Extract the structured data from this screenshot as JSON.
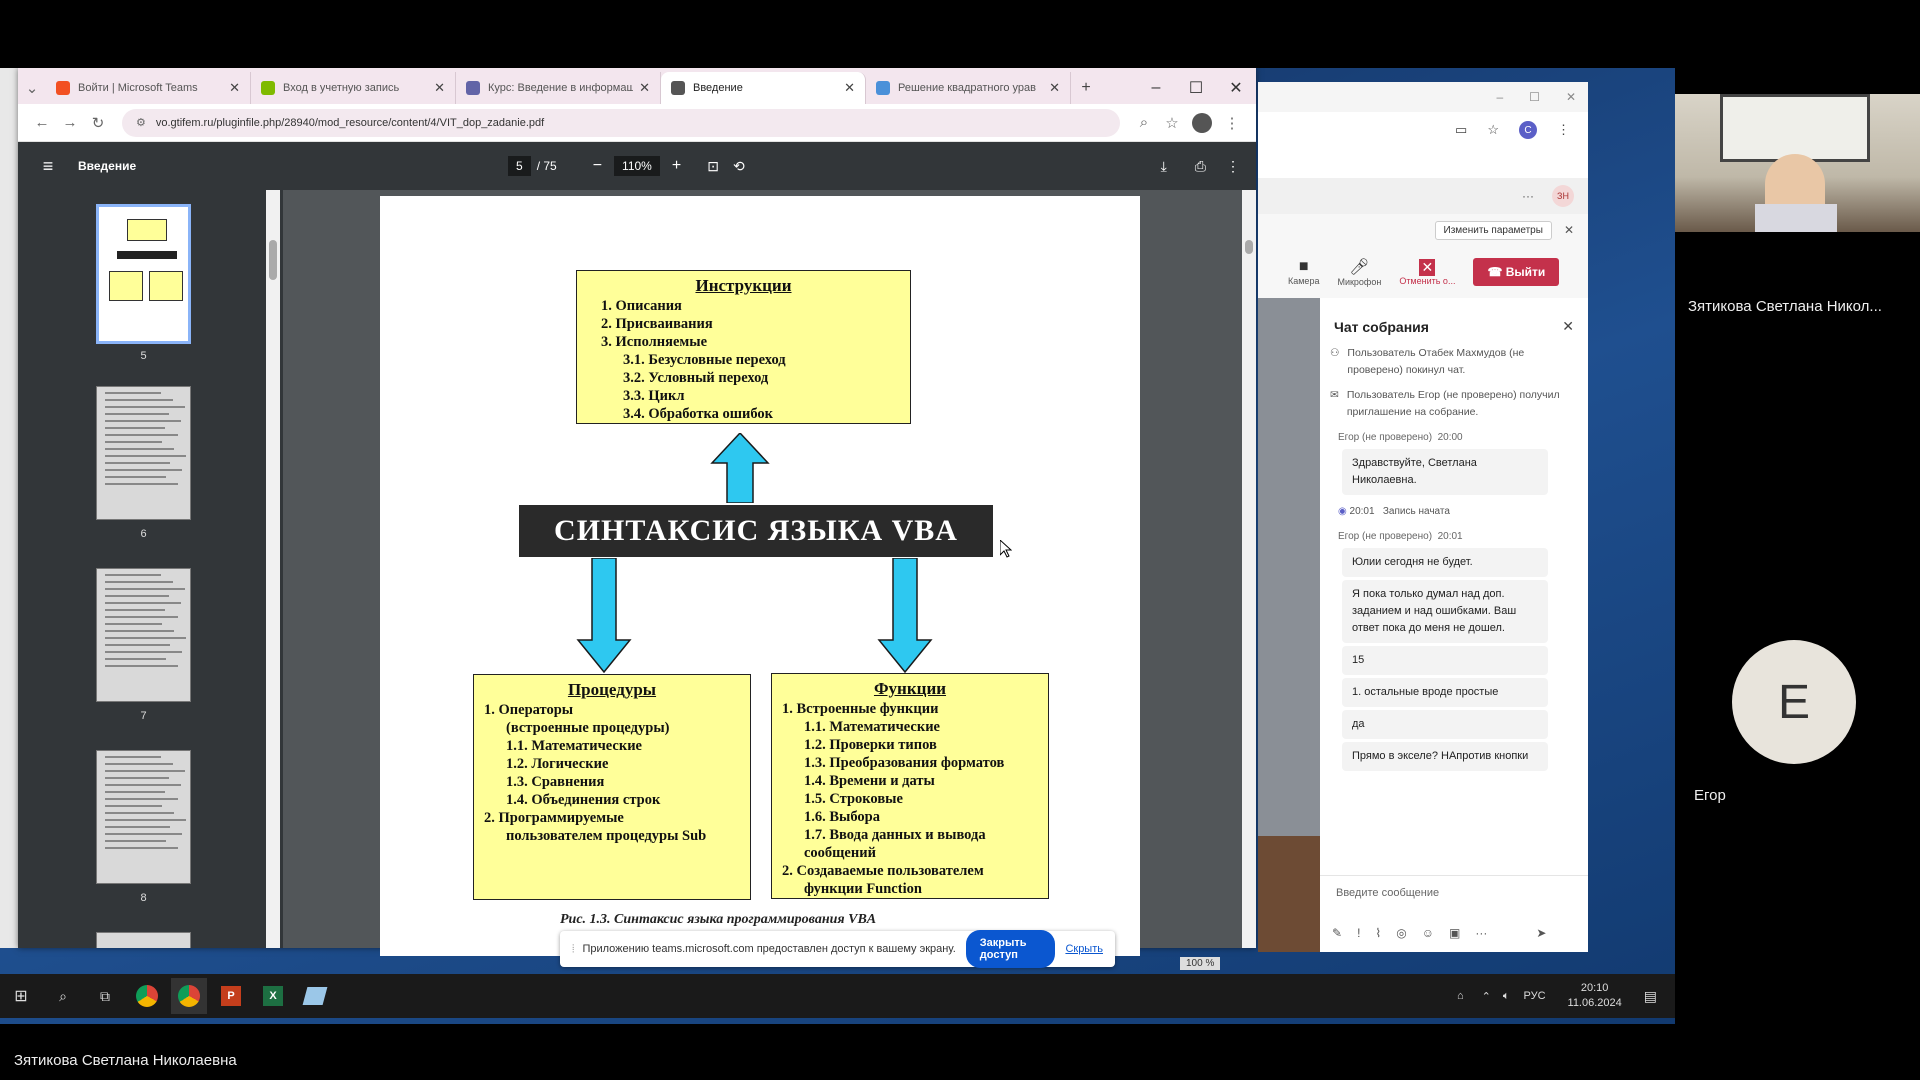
{
  "browser": {
    "tabs": [
      {
        "label": "Войти | Microsoft Teams",
        "color": "#f25022",
        "active": false
      },
      {
        "label": "Вход в учетную запись",
        "color": "#7fba00",
        "active": false
      },
      {
        "label": "Курс: Введение в информаш",
        "color": "#6264a7",
        "active": false
      },
      {
        "label": "Введение",
        "color": "#555555",
        "active": true
      },
      {
        "label": "Решение квадратного урав",
        "color": "#4a90d9",
        "active": false
      }
    ],
    "new_tab": "+",
    "url": "vo.gtifem.ru/pluginfile.php/28940/mod_resource/content/4/VIT_dop_zadanie.pdf",
    "window_controls": {
      "minimize": "–",
      "maximize": "☐",
      "close": "✕"
    }
  },
  "pdf": {
    "title": "Введение",
    "page_current": "5",
    "page_total": "/ 75",
    "zoom": "110%",
    "thumbnails": [
      "5",
      "6",
      "7",
      "8"
    ],
    "diagram": {
      "center": "СИНТАКСИС ЯЗЫКА VBA",
      "instructions": {
        "title": "Инструкции",
        "lines": [
          "1.   Описания",
          "2.   Присваивания",
          "3.   Исполняемые",
          "3.1. Безусловные переход",
          "3.2. Условный переход",
          "3.3. Цикл",
          "3.4. Обработка ошибок"
        ]
      },
      "procedures": {
        "title": "Процедуры",
        "lines": [
          "1.   Операторы",
          "(встроенные процедуры)",
          "1.1. Математические",
          "1.2. Логические",
          "1.3. Сравнения",
          "1.4. Объединения строк",
          "2.   Программируемые",
          "пользователем процедуры Sub"
        ]
      },
      "functions": {
        "title": "Функции",
        "lines": [
          "1.   Встроенные функции",
          "1.1. Математические",
          "1.2. Проверки типов",
          "1.3. Преобразования форматов",
          "1.4. Времени и даты",
          "1.5. Строковые",
          "1.6. Выбора",
          "1.7. Ввода данных и вывода",
          "сообщений",
          "2.   Создаваемые пользователем",
          "функции Function"
        ]
      },
      "caption": "Рис. 1.3. Синтаксис языка программирования VBA"
    }
  },
  "share_bar": {
    "text": "Приложению teams.microsoft.com предоставлен доступ к вашему экрану.",
    "stop_button": "Закрыть доступ",
    "hide_link": "Скрыть",
    "zoom_readout": "100 %"
  },
  "teams": {
    "change_params": "Изменить параметры",
    "controls": {
      "camera": "Камера",
      "mic": "Микрофон",
      "stop_share": "Отменить о...",
      "leave": "Выйти"
    },
    "chat_title": "Чат собрания",
    "system_messages": [
      "Пользователь Отабек Махмудов (не проверено) покинул чат.",
      "Пользователь Егор (не проверено) получил приглашение на собрание."
    ],
    "messages": [
      {
        "author": "Егор (не проверено)",
        "time": "20:00",
        "text": "Здравствуйте, Светлана Николаевна."
      },
      {
        "author": "",
        "time": "20:01",
        "text": "Запись начата"
      },
      {
        "author": "Егор (не проверено)",
        "time": "20:01",
        "text": "Юлии сегодня не будет."
      },
      {
        "author": "",
        "time": "",
        "text": "Я пока только думал над доп. заданием и над ошибками. Ваш ответ пока до меня не дошел."
      },
      {
        "author": "",
        "time": "",
        "text": "15"
      },
      {
        "author": "",
        "time": "",
        "text": "1. остальные вроде простые"
      },
      {
        "author": "",
        "time": "",
        "text": "да"
      },
      {
        "author": "",
        "time": "",
        "text": "Прямо в экселе? НАпротив кнопки"
      }
    ],
    "input_placeholder": "Введите сообщение",
    "badge": "ЗН"
  },
  "taskbar": {
    "lang": "РУС",
    "time": "20:10",
    "date": "11.06.2024"
  },
  "participants": [
    {
      "name": "Зятикова Светлана Никол...",
      "has_video": true
    },
    {
      "name": "Егор",
      "initial": "Е",
      "has_video": false
    }
  ],
  "presenter_caption": "Зятикова Светлана Николаевна"
}
